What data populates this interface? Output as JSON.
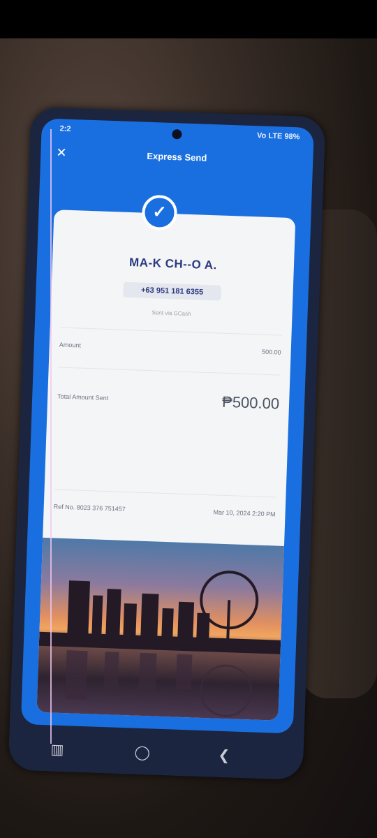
{
  "status_bar": {
    "time": "2:2",
    "indicators": "Vo LTE 98%"
  },
  "app_bar": {
    "close_icon": "close-icon",
    "title": "Express Send"
  },
  "receipt": {
    "success_icon": "checkmark-icon",
    "recipient_name": "MA-K CH--O A.",
    "recipient_phone": "+63 951 181 6355",
    "note": "Sent via GCash",
    "amount_label": "Amount",
    "amount_value": "500.00",
    "total_label": "Total Amount Sent",
    "total_value": "₱500.00",
    "ref_label": "Ref No. 8023 376 751457",
    "date": "Mar 10, 2024 2:20 PM"
  },
  "nav": {
    "recents_icon": "recents-icon",
    "home_icon": "home-icon",
    "back_icon": "back-icon"
  },
  "colors": {
    "primary": "#1a6fe0",
    "card": "#f4f5f7",
    "name_text": "#2b3a80"
  }
}
